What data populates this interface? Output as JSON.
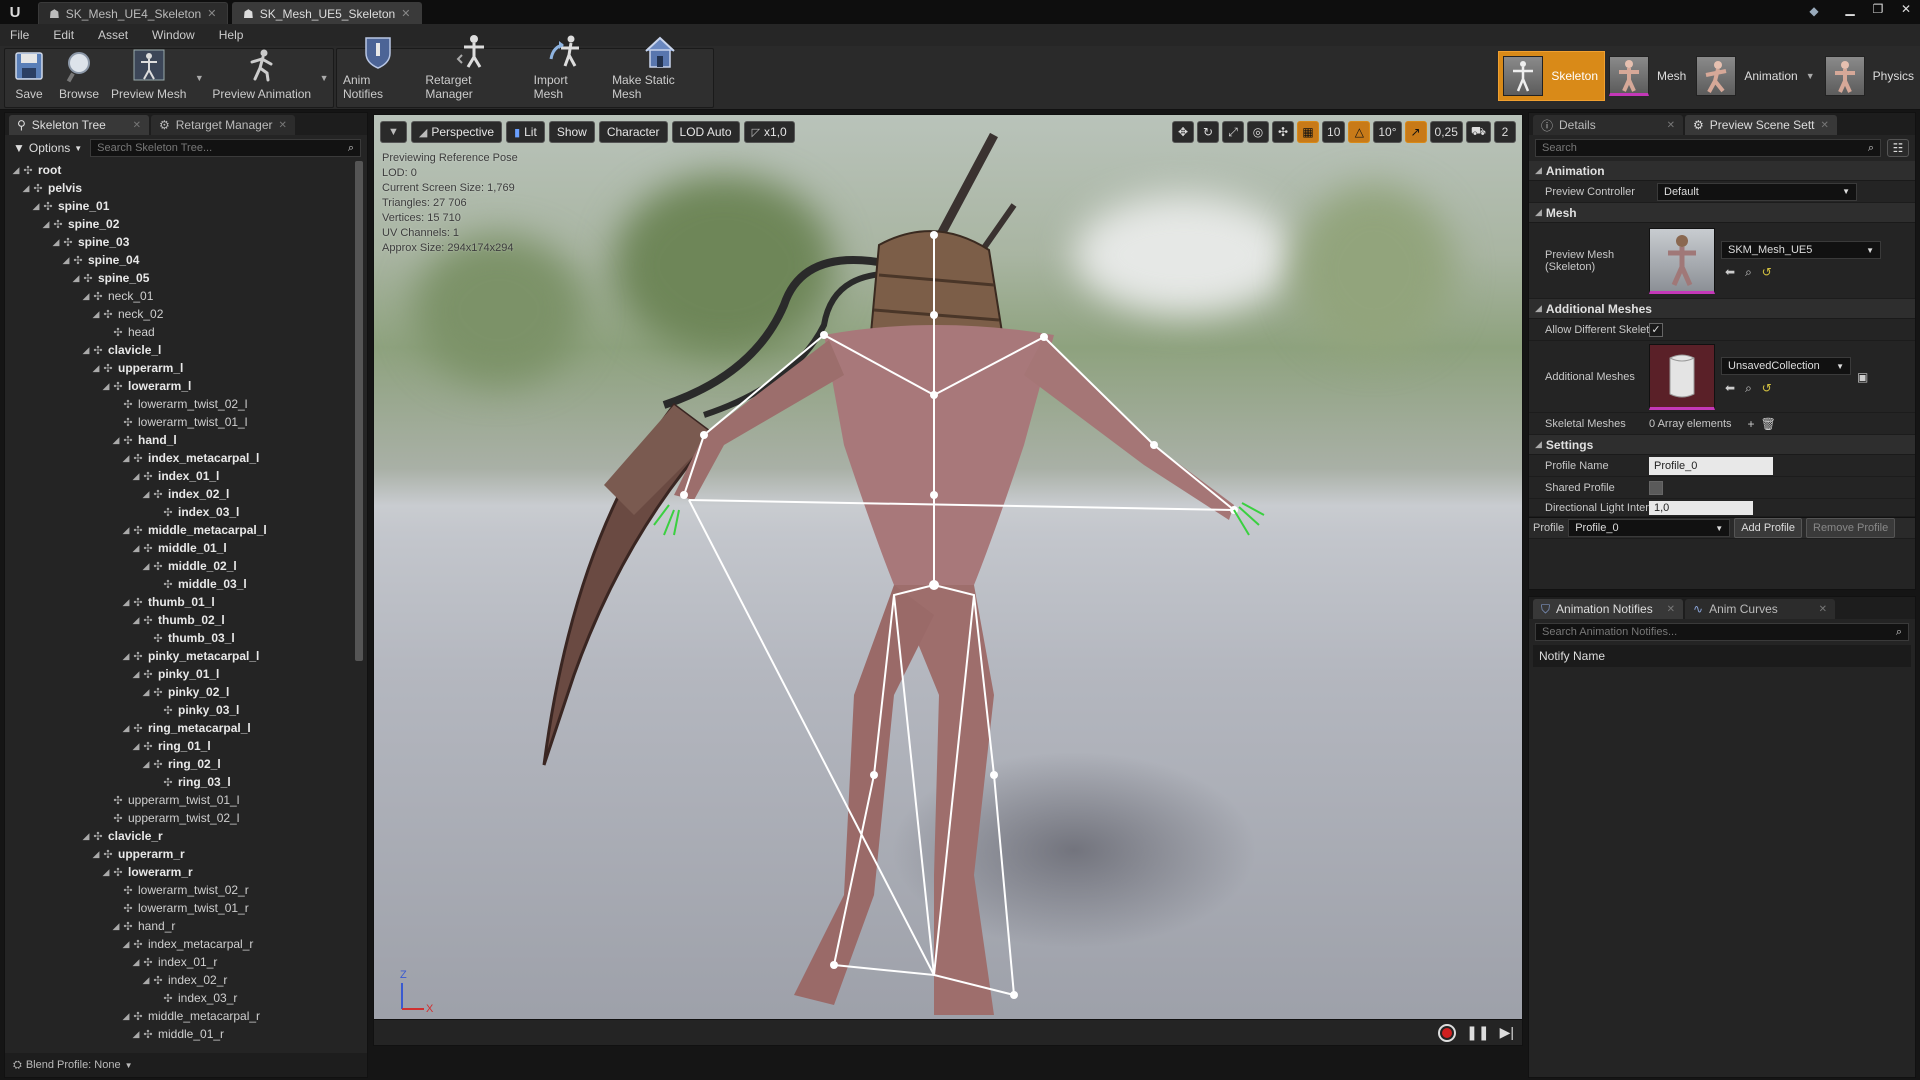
{
  "titlebar": {
    "tabs": [
      {
        "label": "SK_Mesh_UE4_Skeleton",
        "active": false
      },
      {
        "label": "SK_Mesh_UE5_Skeleton",
        "active": true
      }
    ]
  },
  "menu": [
    "File",
    "Edit",
    "Asset",
    "Window",
    "Help"
  ],
  "toolbar": {
    "save": "Save",
    "browse": "Browse",
    "preview_mesh": "Preview Mesh",
    "preview_animation": "Preview Animation",
    "anim_notifies": "Anim Notifies",
    "retarget_manager": "Retarget Manager",
    "import_mesh": "Import Mesh",
    "make_static_mesh": "Make Static Mesh"
  },
  "modes": {
    "skeleton": "Skeleton",
    "mesh": "Mesh",
    "animation": "Animation",
    "physics": "Physics"
  },
  "skeleton_panel": {
    "tab_skeleton_tree": "Skeleton Tree",
    "tab_retarget_manager": "Retarget Manager",
    "options": "Options",
    "search_placeholder": "Search Skeleton Tree...",
    "footer": "Blend Profile: None",
    "bones": [
      {
        "name": "root",
        "depth": 0,
        "exp": true,
        "bold": true
      },
      {
        "name": "pelvis",
        "depth": 1,
        "exp": true,
        "bold": true
      },
      {
        "name": "spine_01",
        "depth": 2,
        "exp": true,
        "bold": true
      },
      {
        "name": "spine_02",
        "depth": 3,
        "exp": true,
        "bold": true
      },
      {
        "name": "spine_03",
        "depth": 4,
        "exp": true,
        "bold": true
      },
      {
        "name": "spine_04",
        "depth": 5,
        "exp": true,
        "bold": true
      },
      {
        "name": "spine_05",
        "depth": 6,
        "exp": true,
        "bold": true
      },
      {
        "name": "neck_01",
        "depth": 7,
        "exp": true,
        "bold": false
      },
      {
        "name": "neck_02",
        "depth": 8,
        "exp": true,
        "bold": false
      },
      {
        "name": "head",
        "depth": 9,
        "exp": false,
        "bold": false
      },
      {
        "name": "clavicle_l",
        "depth": 7,
        "exp": true,
        "bold": true
      },
      {
        "name": "upperarm_l",
        "depth": 8,
        "exp": true,
        "bold": true
      },
      {
        "name": "lowerarm_l",
        "depth": 9,
        "exp": true,
        "bold": true
      },
      {
        "name": "lowerarm_twist_02_l",
        "depth": 10,
        "exp": false,
        "bold": false
      },
      {
        "name": "lowerarm_twist_01_l",
        "depth": 10,
        "exp": false,
        "bold": false
      },
      {
        "name": "hand_l",
        "depth": 10,
        "exp": true,
        "bold": true
      },
      {
        "name": "index_metacarpal_l",
        "depth": 11,
        "exp": true,
        "bold": true
      },
      {
        "name": "index_01_l",
        "depth": 12,
        "exp": true,
        "bold": true
      },
      {
        "name": "index_02_l",
        "depth": 13,
        "exp": true,
        "bold": true
      },
      {
        "name": "index_03_l",
        "depth": 14,
        "exp": false,
        "bold": true
      },
      {
        "name": "middle_metacarpal_l",
        "depth": 11,
        "exp": true,
        "bold": true
      },
      {
        "name": "middle_01_l",
        "depth": 12,
        "exp": true,
        "bold": true
      },
      {
        "name": "middle_02_l",
        "depth": 13,
        "exp": true,
        "bold": true
      },
      {
        "name": "middle_03_l",
        "depth": 14,
        "exp": false,
        "bold": true
      },
      {
        "name": "thumb_01_l",
        "depth": 11,
        "exp": true,
        "bold": true
      },
      {
        "name": "thumb_02_l",
        "depth": 12,
        "exp": true,
        "bold": true
      },
      {
        "name": "thumb_03_l",
        "depth": 13,
        "exp": false,
        "bold": true
      },
      {
        "name": "pinky_metacarpal_l",
        "depth": 11,
        "exp": true,
        "bold": true
      },
      {
        "name": "pinky_01_l",
        "depth": 12,
        "exp": true,
        "bold": true
      },
      {
        "name": "pinky_02_l",
        "depth": 13,
        "exp": true,
        "bold": true
      },
      {
        "name": "pinky_03_l",
        "depth": 14,
        "exp": false,
        "bold": true
      },
      {
        "name": "ring_metacarpal_l",
        "depth": 11,
        "exp": true,
        "bold": true
      },
      {
        "name": "ring_01_l",
        "depth": 12,
        "exp": true,
        "bold": true
      },
      {
        "name": "ring_02_l",
        "depth": 13,
        "exp": true,
        "bold": true
      },
      {
        "name": "ring_03_l",
        "depth": 14,
        "exp": false,
        "bold": true
      },
      {
        "name": "upperarm_twist_01_l",
        "depth": 9,
        "exp": false,
        "bold": false
      },
      {
        "name": "upperarm_twist_02_l",
        "depth": 9,
        "exp": false,
        "bold": false
      },
      {
        "name": "clavicle_r",
        "depth": 7,
        "exp": true,
        "bold": true
      },
      {
        "name": "upperarm_r",
        "depth": 8,
        "exp": true,
        "bold": true
      },
      {
        "name": "lowerarm_r",
        "depth": 9,
        "exp": true,
        "bold": true
      },
      {
        "name": "lowerarm_twist_02_r",
        "depth": 10,
        "exp": false,
        "bold": false
      },
      {
        "name": "lowerarm_twist_01_r",
        "depth": 10,
        "exp": false,
        "bold": false
      },
      {
        "name": "hand_r",
        "depth": 10,
        "exp": true,
        "bold": false
      },
      {
        "name": "index_metacarpal_r",
        "depth": 11,
        "exp": true,
        "bold": false
      },
      {
        "name": "index_01_r",
        "depth": 12,
        "exp": true,
        "bold": false
      },
      {
        "name": "index_02_r",
        "depth": 13,
        "exp": true,
        "bold": false
      },
      {
        "name": "index_03_r",
        "depth": 14,
        "exp": false,
        "bold": false
      },
      {
        "name": "middle_metacarpal_r",
        "depth": 11,
        "exp": true,
        "bold": false
      },
      {
        "name": "middle_01_r",
        "depth": 12,
        "exp": true,
        "bold": false
      }
    ]
  },
  "viewport": {
    "perspective": "Perspective",
    "lit": "Lit",
    "show": "Show",
    "character": "Character",
    "lod": "LOD Auto",
    "speed": "x1,0",
    "grid_size": "10",
    "rot_snap": "10°",
    "scale_snap": "0,25",
    "cam_speed": "2",
    "info": [
      "Previewing Reference Pose",
      "LOD: 0",
      "Current Screen Size: 1,769",
      "Triangles: 27 706",
      "Vertices: 15 710",
      "UV Channels: 1",
      "Approx Size: 294x174x294"
    ],
    "axis_z": "Z",
    "axis_x": "X"
  },
  "details": {
    "tab_details": "Details",
    "tab_preview": "Preview Scene Sett",
    "search_placeholder": "Search",
    "cat_animation": "Animation",
    "preview_controller_label": "Preview Controller",
    "preview_controller_value": "Default",
    "cat_mesh": "Mesh",
    "preview_mesh_label": "Preview Mesh (Skeleton)",
    "preview_mesh_value": "SKM_Mesh_UE5",
    "cat_additional": "Additional Meshes",
    "allow_diff_label": "Allow Different Skelet",
    "additional_meshes_label": "Additional Meshes",
    "additional_meshes_value": "UnsavedCollection",
    "skeletal_meshes_label": "Skeletal Meshes",
    "skeletal_meshes_value": "0 Array elements",
    "cat_settings": "Settings",
    "profile_name_label": "Profile Name",
    "profile_name_value": "Profile_0",
    "shared_profile_label": "Shared Profile",
    "dir_light_label": "Directional Light Inten",
    "dir_light_value": "1,0",
    "profile_label": "Profile",
    "profile_value": "Profile_0",
    "add_profile": "Add Profile",
    "remove_profile": "Remove Profile"
  },
  "notifies": {
    "tab_notifies": "Animation Notifies",
    "tab_curves": "Anim Curves",
    "search_placeholder": "Search Animation Notifies...",
    "column": "Notify Name"
  },
  "colors": {
    "accent_orange": "#d98a18",
    "record_red": "#d02020"
  }
}
